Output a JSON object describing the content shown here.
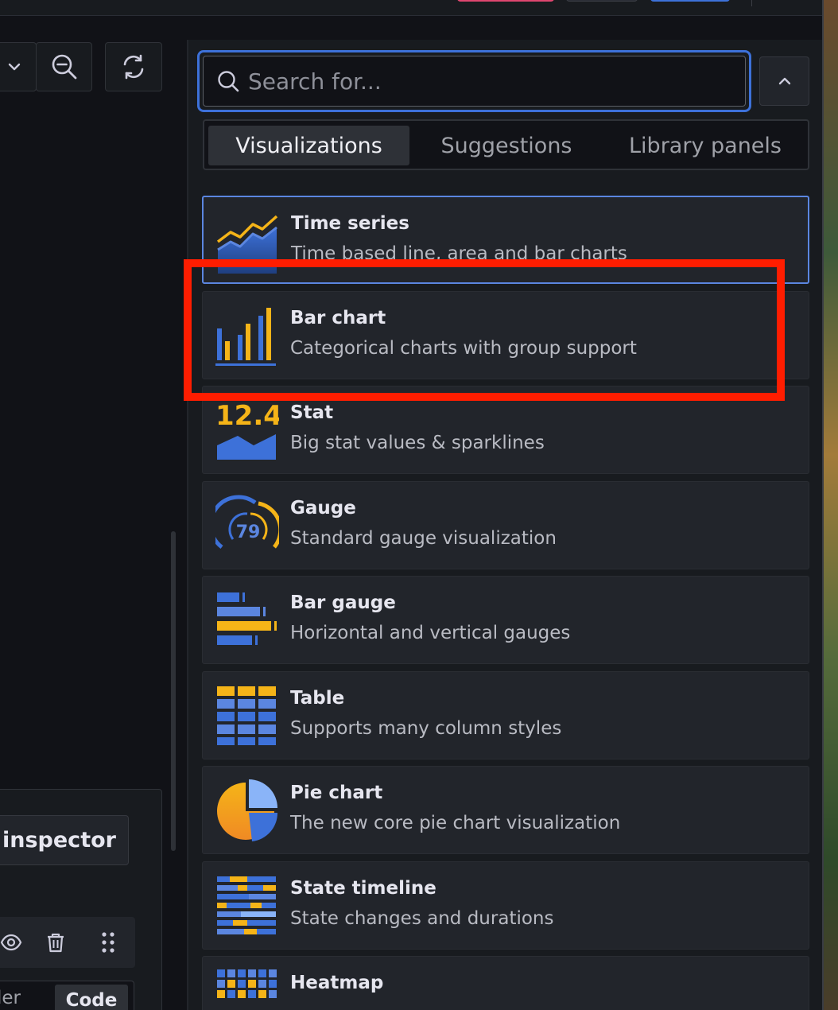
{
  "search": {
    "placeholder": "Search for..."
  },
  "tabs": [
    {
      "label": "Visualizations",
      "active": true
    },
    {
      "label": "Suggestions",
      "active": false
    },
    {
      "label": "Library panels",
      "active": false
    }
  ],
  "visualizations": [
    {
      "name": "Time series",
      "description": "Time based line, area and bar charts",
      "icon": "time-series-icon",
      "selected": true
    },
    {
      "name": "Bar chart",
      "description": "Categorical charts with group support",
      "icon": "bar-chart-icon",
      "highlighted": true
    },
    {
      "name": "Stat",
      "description": "Big stat values & sparklines",
      "icon": "stat-icon",
      "icon_text": "12.4"
    },
    {
      "name": "Gauge",
      "description": "Standard gauge visualization",
      "icon": "gauge-icon",
      "icon_text": "79"
    },
    {
      "name": "Bar gauge",
      "description": "Horizontal and vertical gauges",
      "icon": "bar-gauge-icon"
    },
    {
      "name": "Table",
      "description": "Supports many column styles",
      "icon": "table-icon"
    },
    {
      "name": "Pie chart",
      "description": "The new core pie chart visualization",
      "icon": "pie-chart-icon"
    },
    {
      "name": "State timeline",
      "description": "State changes and durations",
      "icon": "state-timeline-icon"
    },
    {
      "name": "Heatmap",
      "description": "",
      "icon": "heatmap-icon"
    }
  ],
  "left": {
    "inspector_label": "inspector",
    "builder_label": "ilder",
    "code_label": "Code"
  },
  "colors": {
    "accent": "#3d71d9",
    "highlight": "#ff1d00",
    "yellow": "#f5b418",
    "blue": "#3d71d9"
  }
}
